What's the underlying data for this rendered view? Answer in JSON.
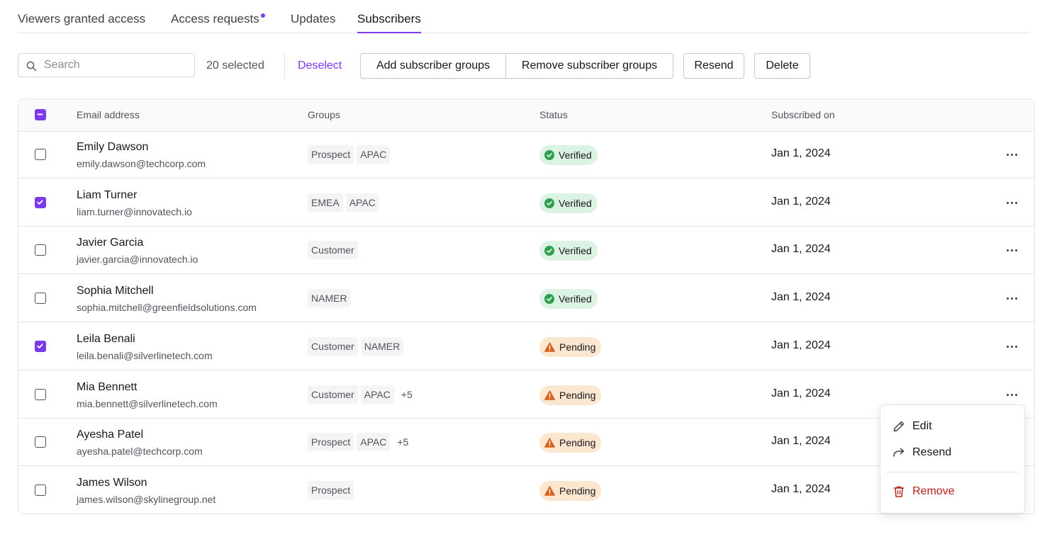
{
  "tabs": [
    {
      "label": "Viewers granted access",
      "active": false
    },
    {
      "label": "Access requests",
      "active": false,
      "has_dot": true
    },
    {
      "label": "Updates",
      "active": false
    },
    {
      "label": "Subscribers",
      "active": true
    }
  ],
  "toolbar": {
    "search_placeholder": "Search",
    "search_value": "",
    "selected_count": "20 selected",
    "deselect_label": "Deselect",
    "add_groups_label": "Add subscriber groups",
    "remove_groups_label": "Remove subscriber groups",
    "resend_label": "Resend",
    "delete_label": "Delete"
  },
  "table": {
    "columns": {
      "email": "Email address",
      "groups": "Groups",
      "status": "Status",
      "subscribed_on": "Subscribed on"
    },
    "rows": [
      {
        "name": "Emily Dawson",
        "email": "emily.dawson@techcorp.com",
        "groups": [
          "Prospect",
          "APAC"
        ],
        "more": "",
        "status": "Verified",
        "status_type": "verified",
        "date": "Jan 1, 2024",
        "checked": false
      },
      {
        "name": "Liam Turner",
        "email": "liam.turner@innovatech.io",
        "groups": [
          "EMEA",
          "APAC"
        ],
        "more": "",
        "status": "Verified",
        "status_type": "verified",
        "date": "Jan 1, 2024",
        "checked": true
      },
      {
        "name": "Javier Garcia",
        "email": "javier.garcia@innovatech.io",
        "groups": [
          "Customer"
        ],
        "more": "",
        "status": "Verified",
        "status_type": "verified",
        "date": "Jan 1, 2024",
        "checked": false
      },
      {
        "name": "Sophia Mitchell",
        "email": "sophia.mitchell@greenfieldsolutions.com",
        "groups": [
          "NAMER"
        ],
        "more": "",
        "status": "Verified",
        "status_type": "verified",
        "date": "Jan 1, 2024",
        "checked": false
      },
      {
        "name": "Leila Benali",
        "email": "leila.benali@silverlinetech.com",
        "groups": [
          "Customer",
          "NAMER"
        ],
        "more": "",
        "status": "Pending",
        "status_type": "pending",
        "date": "Jan 1, 2024",
        "checked": true
      },
      {
        "name": "Mia Bennett",
        "email": "mia.bennett@silverlinetech.com",
        "groups": [
          "Customer",
          "APAC"
        ],
        "more": "+5",
        "status": "Pending",
        "status_type": "pending",
        "date": "Jan 1, 2024",
        "checked": false
      },
      {
        "name": "Ayesha Patel",
        "email": "ayesha.patel@techcorp.com",
        "groups": [
          "Prospect",
          "APAC"
        ],
        "more": "+5",
        "status": "Pending",
        "status_type": "pending",
        "date": "Jan 1, 2024",
        "checked": false
      },
      {
        "name": "James Wilson",
        "email": "james.wilson@skylinegroup.net",
        "groups": [
          "Prospect"
        ],
        "more": "",
        "status": "Pending",
        "status_type": "pending",
        "date": "Jan 1, 2024",
        "checked": false
      }
    ]
  },
  "row_menu": {
    "edit_label": "Edit",
    "resend_label": "Resend",
    "remove_label": "Remove"
  },
  "colors": {
    "accent": "#7c3aed",
    "verified_bg": "#dcf2e2",
    "verified_icon": "#2e9e4f",
    "pending_bg": "#fbe6cf",
    "pending_icon": "#d9601a",
    "danger": "#b42318"
  },
  "icons": {
    "search": "search-icon",
    "verified": "check-circle-icon",
    "pending": "warning-triangle-icon",
    "row_actions": "more-horizontal-icon",
    "edit": "pencil-icon",
    "resend": "forward-arrow-icon",
    "remove": "trash-icon"
  }
}
